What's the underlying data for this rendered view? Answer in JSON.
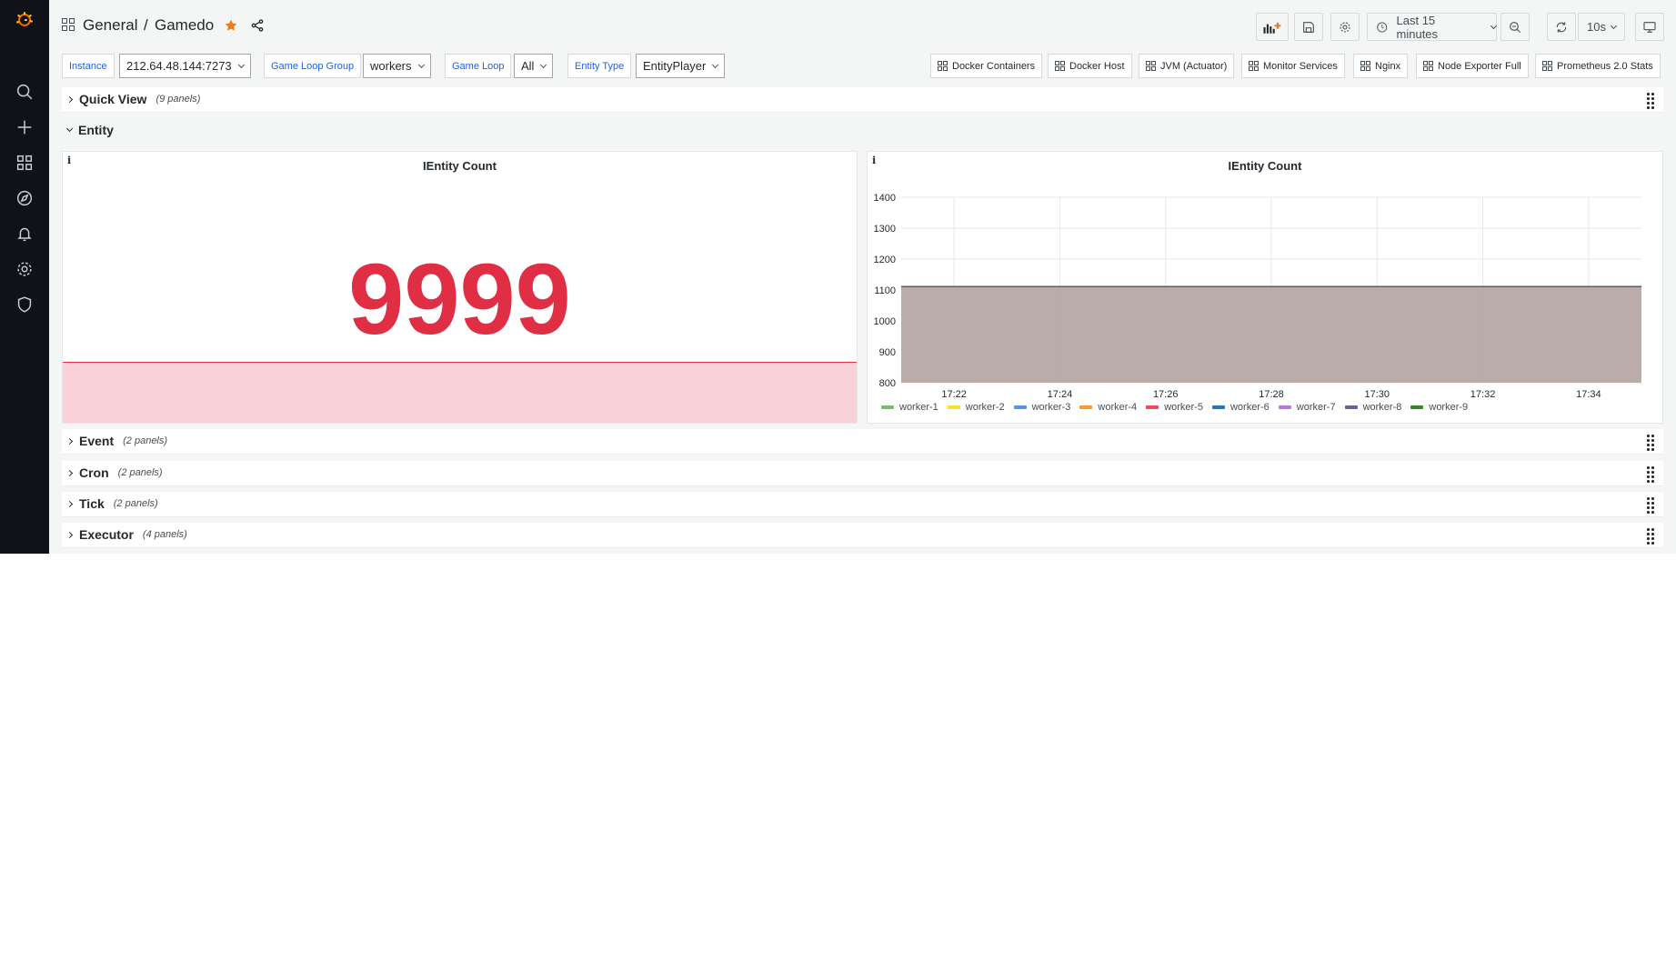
{
  "breadcrumb": {
    "folder": "General",
    "separator": "/",
    "dashboard": "Gamedo"
  },
  "toolbar": {
    "time_range": "Last 15 minutes",
    "refresh_interval": "10s"
  },
  "variables": [
    {
      "label": "Instance",
      "value": "212.64.48.144:7273"
    },
    {
      "label": "Game Loop Group",
      "value": "workers"
    },
    {
      "label": "Game Loop",
      "value": "All"
    },
    {
      "label": "Entity Type",
      "value": "EntityPlayer"
    }
  ],
  "dashboard_links": [
    "Docker Containers",
    "Docker Host",
    "JVM (Actuator)",
    "Monitor Services",
    "Nginx",
    "Node Exporter Full",
    "Prometheus 2.0 Stats"
  ],
  "rows": [
    {
      "title": "Quick View",
      "count": "(9 panels)"
    },
    {
      "title": "Entity",
      "count": ""
    },
    {
      "title": "Event",
      "count": "(2 panels)"
    },
    {
      "title": "Cron",
      "count": "(2 panels)"
    },
    {
      "title": "Tick",
      "count": "(2 panels)"
    },
    {
      "title": "Executor",
      "count": "(4 panels)"
    }
  ],
  "stat_panel": {
    "info": "i",
    "title": "IEntity Count",
    "value": "9999",
    "color": "#e02f44"
  },
  "graph_panel": {
    "info": "i",
    "title": "IEntity Count"
  },
  "chart_data": {
    "type": "area",
    "title": "IEntity Count",
    "x": [
      "17:21",
      "17:35"
    ],
    "xticks": [
      "17:22",
      "17:24",
      "17:26",
      "17:28",
      "17:30",
      "17:32",
      "17:34"
    ],
    "ylim": [
      800,
      1400
    ],
    "yticks": [
      "800",
      "900",
      "1000",
      "1100",
      "1200",
      "1300",
      "1400"
    ],
    "grid": true,
    "legend_position": "bottom-left",
    "fill_color": "#b6a8a6",
    "series": [
      {
        "name": "worker-1",
        "color": "#73bf69",
        "values": [
          1111,
          1111
        ]
      },
      {
        "name": "worker-2",
        "color": "#fade2a",
        "values": [
          1111,
          1111
        ]
      },
      {
        "name": "worker-3",
        "color": "#5794f2",
        "values": [
          1111,
          1111
        ]
      },
      {
        "name": "worker-4",
        "color": "#ff9830",
        "values": [
          1111,
          1111
        ]
      },
      {
        "name": "worker-5",
        "color": "#f2495c",
        "values": [
          1111,
          1111
        ]
      },
      {
        "name": "worker-6",
        "color": "#1f78c1",
        "values": [
          1111,
          1111
        ]
      },
      {
        "name": "worker-7",
        "color": "#b877d9",
        "values": [
          1111,
          1111
        ]
      },
      {
        "name": "worker-8",
        "color": "#705da0",
        "values": [
          1111,
          1111
        ]
      },
      {
        "name": "worker-9",
        "color": "#37872d",
        "values": [
          1111,
          1111
        ]
      }
    ]
  }
}
